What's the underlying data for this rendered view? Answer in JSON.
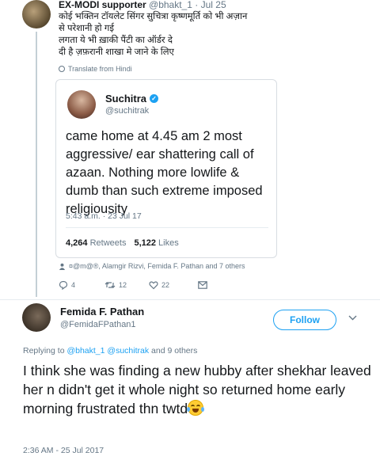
{
  "tweet1": {
    "name": "EX-MODI supporter",
    "handle": "@bhakt_1",
    "date": "Jul 25",
    "lines": [
      "कोई भक्तिन टॉयलेट सिंगर सुचित्रा कृष्णमूर्ति को भी अज़ान",
      "से परेशानी हो गई",
      "लगता ये भी ख़ाकी पैंटी का ऑर्डर दे",
      "दी है ज़फ़रानी शाखा मे जाने के लिए"
    ],
    "translate_label": "Translate from Hindi",
    "liked_by": "¤@m@®, Alamgir Rizvi, Femida F. Pathan and 7 others",
    "actions": {
      "replies": "4",
      "retweets": "12",
      "likes": "22"
    }
  },
  "quoted": {
    "name": "Suchitra",
    "handle": "@suchitrak",
    "text": "came home at 4.45 am 2 most aggressive/ ear shattering call of azaan. Nothing more lowlife & dumb than such extreme imposed religiousity",
    "time": "5:43 a.m. · 23 Jul 17",
    "retweets_count": "4,264",
    "retweets_label": "Retweets",
    "likes_count": "5,122",
    "likes_label": "Likes"
  },
  "tweet2": {
    "name": "Femida F. Pathan",
    "handle": "@FemidaFPathan1",
    "follow_label": "Follow",
    "reply_prefix": "Replying to",
    "reply_user1": "@bhakt_1",
    "reply_user2": "@suchitrak",
    "reply_suffix": "and 9 others",
    "text": "I think she was finding a new hubby after shekhar leaved her n didn't get it whole night so returned home early morning frustrated thn twtd",
    "time": "2:36 AM - 25 Jul 2017"
  },
  "colors": {
    "accent": "#1da1f2",
    "muted": "#657786",
    "text": "#14171a",
    "border": "#e6ecf0"
  }
}
